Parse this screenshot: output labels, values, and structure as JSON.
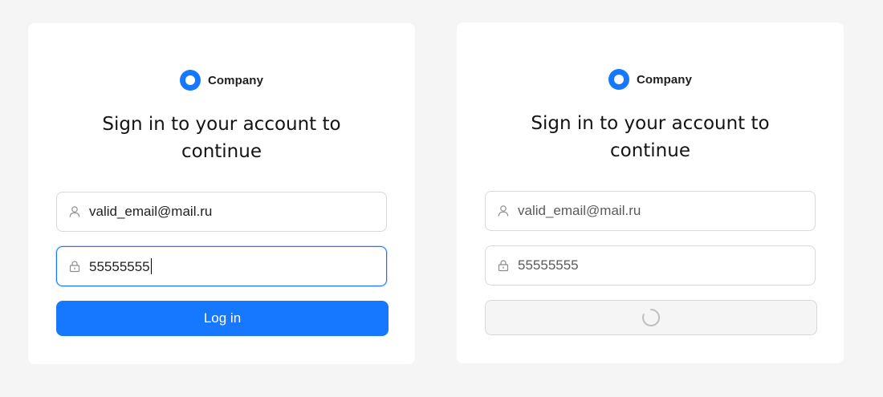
{
  "left_form": {
    "brand": "Company",
    "title": "Sign in to your account to continue",
    "email_value": "valid_email@mail.ru",
    "password_value": "55555555",
    "login_button": "Log in"
  },
  "right_form": {
    "brand": "Company",
    "title": "Sign in to your account to continue",
    "email_value": "valid_email@mail.ru",
    "password_value": "55555555",
    "button_state": "loading"
  },
  "icons": {
    "logo": "company-logo-icon",
    "user": "user-icon",
    "lock": "lock-icon",
    "spinner": "loading-spinner-icon"
  },
  "colors": {
    "primary": "#1677ff",
    "background": "#f5f5f5",
    "card": "#ffffff",
    "border": "#d9d9d9"
  }
}
